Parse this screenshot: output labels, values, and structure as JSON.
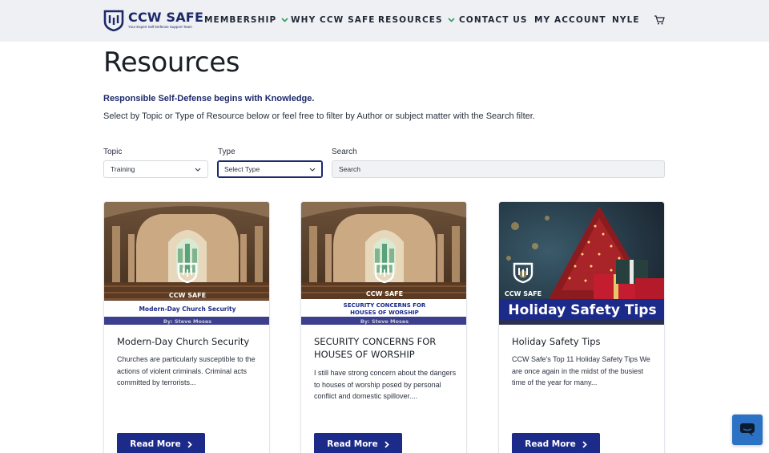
{
  "brand": {
    "name": "CCW SAFE",
    "tagline": "Your Expert Self-Defense Support Team",
    "color": "#1c2a6b"
  },
  "nav": {
    "membership": "MEMBERSHIP",
    "why": "WHY CCW SAFE",
    "resources": "RESOURCES",
    "contact": "CONTACT US",
    "account": "MY ACCOUNT",
    "user": "NYLE"
  },
  "page": {
    "title": "Resources",
    "intro_strong": "Responsible Self-Defense begins with Knowledge.",
    "intro": "Select by Topic or Type of Resource below or feel free to filter by Author or subject matter with the Search filter."
  },
  "filters": {
    "topic_label": "Topic",
    "topic_value": "Training",
    "type_label": "Type",
    "type_value": "Select Type",
    "search_label": "Search",
    "search_placeholder": "Search"
  },
  "cards": [
    {
      "title": "Modern-Day Church Security",
      "banner": "Modern-Day Church Security",
      "byline": "By: Steve Moses",
      "logo_text": "CCW SAFE",
      "description": "Churches are particularly susceptible to the actions of violent criminals. Criminal acts committed by terrorists...",
      "button": "Read More"
    },
    {
      "title": "SECURITY CONCERNS FOR HOUSES OF WORSHIP",
      "banner_line1": "SECURITY CONCERNS FOR",
      "banner_line2": "HOUSES OF WORSHIP",
      "byline": "By: Steve Moses",
      "logo_text": "CCW SAFE",
      "description": "I still have strong concern about the dangers to houses of worship posed by personal conflict and domestic spillover....",
      "button": "Read More"
    },
    {
      "title": "Holiday Safety Tips",
      "banner": "Holiday Safety Tips",
      "logo_text": "CCW SAFE",
      "description": "CCW Safe's Top 11 Holiday Safety Tips We are once again in the midst of the busiest time of the year for many...",
      "button": "Read More"
    }
  ],
  "icons": {
    "cart": "cart-icon",
    "chat": "chat-icon"
  }
}
